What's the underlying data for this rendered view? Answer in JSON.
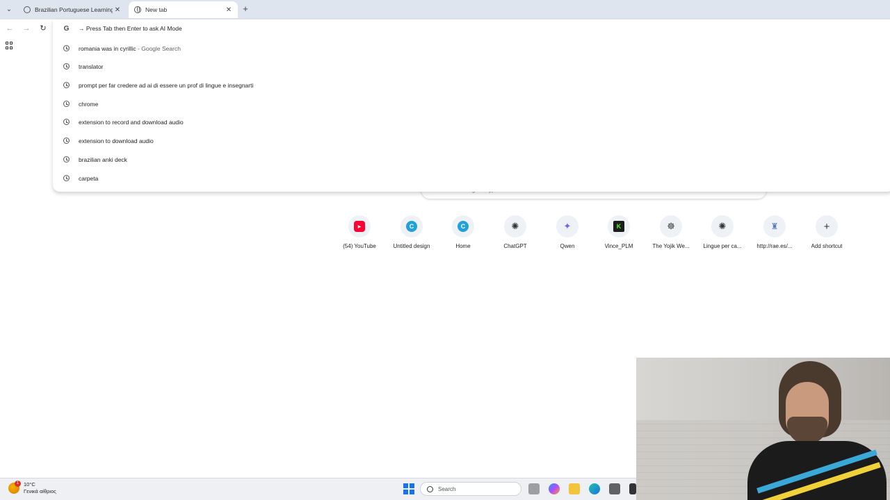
{
  "tabs": [
    {
      "title": "Brazilian Portuguese Learning",
      "close": "✕",
      "active": false
    },
    {
      "title": "New tab",
      "close": "✕",
      "active": true
    }
  ],
  "new_tab_symbol": "+",
  "toolbar": {
    "back_icon": "←",
    "forward_icon": "→",
    "reload_icon": "↻"
  },
  "omnibox": {
    "ai_row": {
      "text": "→ Press Tab then Enter to ask AI Mode"
    },
    "suggestions": [
      {
        "text": "romania was in cyrillic",
        "suffix": " - Google Search"
      },
      {
        "text": "translator",
        "suffix": ""
      },
      {
        "text": "prompt per far credere ad ai di essere un prof di lingue e insegnarti",
        "suffix": ""
      },
      {
        "text": "chrome",
        "suffix": ""
      },
      {
        "text": "extension to record and download audio",
        "suffix": ""
      },
      {
        "text": "extension to download audio",
        "suffix": ""
      },
      {
        "text": "brazilian anki deck",
        "suffix": ""
      },
      {
        "text": "carpeta",
        "suffix": ""
      }
    ]
  },
  "ntp": {
    "search_placeholder": "Search Google or type a URL"
  },
  "shortcuts": [
    {
      "label": "(54) YouTube",
      "glyph": "▶",
      "color": "#ff0033"
    },
    {
      "label": "Untitled design",
      "glyph": "C",
      "color": "#22a0d8"
    },
    {
      "label": "Home",
      "glyph": "C",
      "color": "#22a0d8"
    },
    {
      "label": "ChatGPT",
      "glyph": "✺",
      "color": "#333333"
    },
    {
      "label": "Qwen",
      "glyph": "✦",
      "color": "#7b5cf0"
    },
    {
      "label": "Vince_PLM",
      "glyph": "K",
      "color": "#1c1c1c"
    },
    {
      "label": "The Yojik We...",
      "glyph": "☸",
      "color": "#444444"
    },
    {
      "label": "Lingue per ca...",
      "glyph": "✺",
      "color": "#333333"
    },
    {
      "label": "http://rae.es/...",
      "glyph": "♜",
      "color": "#5b7bb5"
    },
    {
      "label": "Add shortcut",
      "glyph": "+",
      "color": "#333333"
    }
  ],
  "taskbar": {
    "weather_temp": "10°C",
    "weather_desc": "Γενικά αίθριος",
    "weather_badge": "1",
    "search_label": "Search"
  }
}
